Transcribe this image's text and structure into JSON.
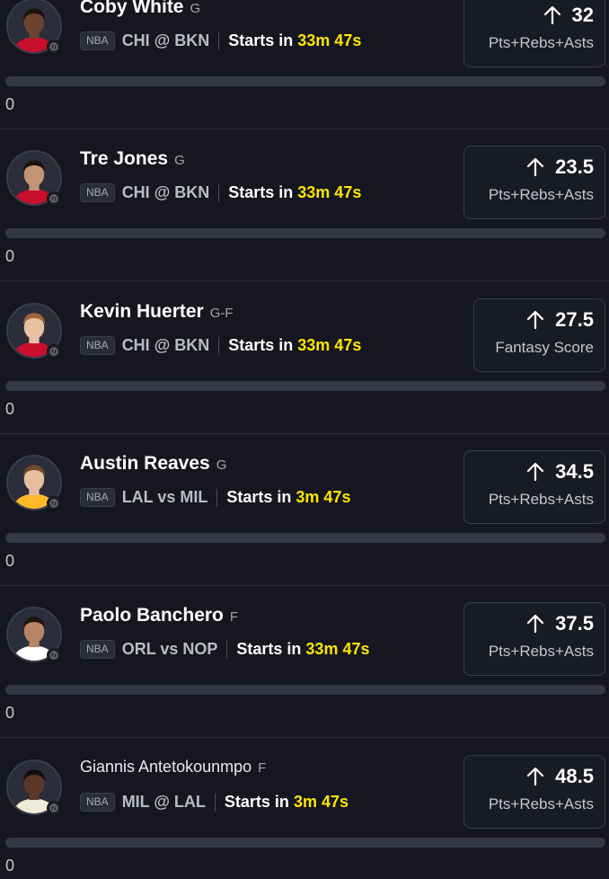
{
  "colors": {
    "background": "#15161f",
    "countdown": "#ffe600",
    "bar_track": "#353744"
  },
  "players": [
    {
      "name": "Coby White",
      "position": "G",
      "league": "NBA",
      "matchup": "CHI @ BKN",
      "starts_label": "Starts in",
      "time": "33m 47s",
      "line": "32",
      "stat": "Pts+Rebs+Asts",
      "arrow_icon": "arrow-up-icon",
      "progress": 0,
      "count": "0",
      "skin": "#6b4330",
      "hair": "#1a120d",
      "jersey": "#c8102e"
    },
    {
      "name": "Tre Jones",
      "position": "G",
      "league": "NBA",
      "matchup": "CHI @ BKN",
      "starts_label": "Starts in",
      "time": "33m 47s",
      "line": "23.5",
      "stat": "Pts+Rebs+Asts",
      "arrow_icon": "arrow-up-icon",
      "progress": 0,
      "count": "0",
      "skin": "#c49474",
      "hair": "#1c1410",
      "jersey": "#c8102e"
    },
    {
      "name": "Kevin Huerter",
      "position": "G-F",
      "league": "NBA",
      "matchup": "CHI @ BKN",
      "starts_label": "Starts in",
      "time": "33m 47s",
      "line": "27.5",
      "stat": "Fantasy Score",
      "arrow_icon": "arrow-up-icon",
      "progress": 0,
      "count": "0",
      "skin": "#e8c1a5",
      "hair": "#a0663a",
      "jersey": "#c8102e"
    },
    {
      "name": "Austin Reaves",
      "position": "G",
      "league": "NBA",
      "matchup": "LAL vs MIL",
      "starts_label": "Starts in",
      "time": "3m 47s",
      "line": "34.5",
      "stat": "Pts+Rebs+Asts",
      "arrow_icon": "arrow-up-icon",
      "progress": 0,
      "count": "0",
      "skin": "#e6bf9f",
      "hair": "#6e4a2c",
      "jersey": "#fdb927"
    },
    {
      "name": "Paolo Banchero",
      "position": "F",
      "league": "NBA",
      "matchup": "ORL vs NOP",
      "starts_label": "Starts in",
      "time": "33m 47s",
      "line": "37.5",
      "stat": "Pts+Rebs+Asts",
      "arrow_icon": "arrow-up-icon",
      "progress": 0,
      "count": "0",
      "skin": "#b98466",
      "hair": "#1f1612",
      "jersey": "#ffffff"
    },
    {
      "name": "Giannis Antetokounmpo",
      "position": "F",
      "league": "NBA",
      "matchup": "MIL @ LAL",
      "starts_label": "Starts in",
      "time": "3m 47s",
      "line": "48.5",
      "stat": "Pts+Rebs+Asts",
      "arrow_icon": "arrow-up-icon",
      "progress": 0,
      "count": "0",
      "skin": "#5a3826",
      "hair": "#140e0a",
      "jersey": "#f0ebd8"
    }
  ]
}
